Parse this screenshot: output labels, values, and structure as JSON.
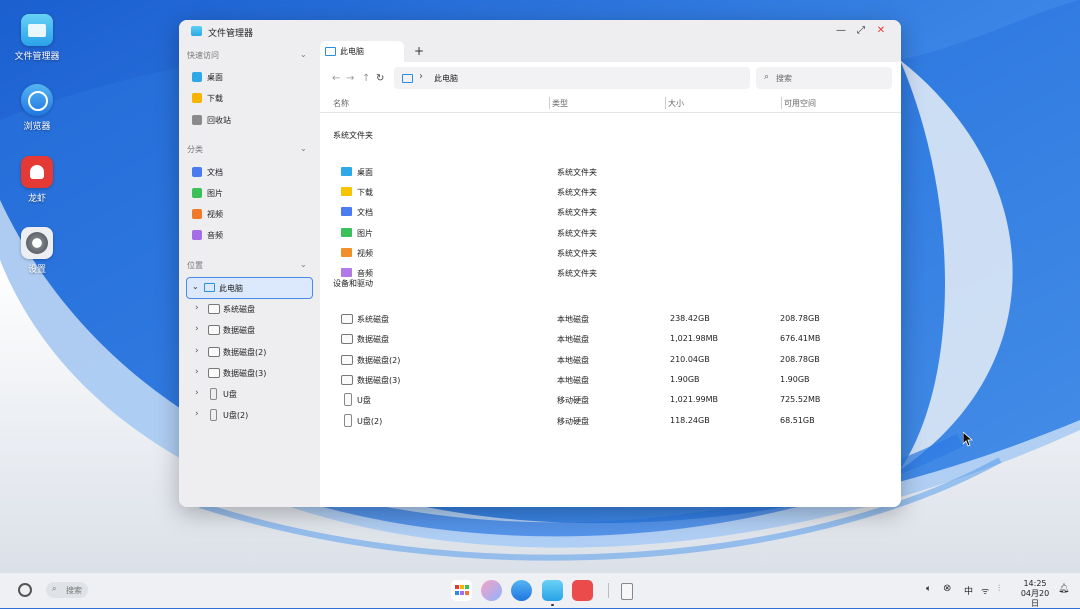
{
  "desktop": {
    "icons": [
      {
        "label": "文件管理器",
        "icon": "file-manager-icon",
        "color": "#3fb6ef"
      },
      {
        "label": "浏览器",
        "icon": "browser-icon",
        "color": "#2d8ae8"
      },
      {
        "label": "龙虾",
        "icon": "lobster-icon",
        "color": "#e53935"
      },
      {
        "label": "设置",
        "icon": "settings-icon",
        "color": "#7b7f86"
      }
    ]
  },
  "window": {
    "title": "文件管理器",
    "controls": {
      "minimize": "—",
      "restore": "⤢",
      "close": "✕"
    }
  },
  "sidebar": {
    "quick_access": {
      "label": "快速访问",
      "items": [
        {
          "label": "桌面",
          "icon": "desktop-icon",
          "color": "#2fa8e8"
        },
        {
          "label": "下载",
          "icon": "download-icon",
          "color": "#f6b400"
        },
        {
          "label": "回收站",
          "icon": "trash-icon",
          "color": "#8a8a8a"
        }
      ]
    },
    "categories": {
      "label": "分类",
      "items": [
        {
          "label": "文档",
          "icon": "document-icon",
          "color": "#4a7cf0"
        },
        {
          "label": "图片",
          "icon": "picture-icon",
          "color": "#3cc15a"
        },
        {
          "label": "视频",
          "icon": "video-icon",
          "color": "#f07a2a"
        },
        {
          "label": "音频",
          "icon": "audio-icon",
          "color": "#a56ee6"
        }
      ]
    },
    "locations": {
      "label": "位置",
      "this_pc": "此电脑",
      "drives": [
        "系统磁盘",
        "数据磁盘",
        "数据磁盘(2)",
        "数据磁盘(3)",
        "U盘",
        "U盘(2)"
      ]
    }
  },
  "tabs": {
    "items": [
      {
        "label": "此电脑"
      }
    ],
    "add": "+"
  },
  "address": {
    "back": "←",
    "forward": "→",
    "up": "↑",
    "refresh": "↻",
    "separator": "›",
    "crumb": "此电脑",
    "search_placeholder": "搜索"
  },
  "columns": {
    "name": "名称",
    "type": "类型",
    "size": "大小",
    "free": "可用空间"
  },
  "system_folders": {
    "label": "系统文件夹",
    "rows": [
      {
        "name": "桌面",
        "type": "系统文件夹",
        "color": "#2fa8e8"
      },
      {
        "name": "下载",
        "type": "系统文件夹",
        "color": "#f6c400"
      },
      {
        "name": "文档",
        "type": "系统文件夹",
        "color": "#4a7cf0"
      },
      {
        "name": "图片",
        "type": "系统文件夹",
        "color": "#3cc15a"
      },
      {
        "name": "视频",
        "type": "系统文件夹",
        "color": "#f0902a"
      },
      {
        "name": "音频",
        "type": "系统文件夹",
        "color": "#b07ae8"
      }
    ]
  },
  "devices": {
    "label": "设备和驱动",
    "rows": [
      {
        "name": "系统磁盘",
        "type": "本地磁盘",
        "size": "238.42GB",
        "free": "208.78GB",
        "kind": "disk"
      },
      {
        "name": "数据磁盘",
        "type": "本地磁盘",
        "size": "1,021.98MB",
        "free": "676.41MB",
        "kind": "disk"
      },
      {
        "name": "数据磁盘(2)",
        "type": "本地磁盘",
        "size": "210.04GB",
        "free": "208.78GB",
        "kind": "disk"
      },
      {
        "name": "数据磁盘(3)",
        "type": "本地磁盘",
        "size": "1.90GB",
        "free": "1.90GB",
        "kind": "disk"
      },
      {
        "name": "U盘",
        "type": "移动硬盘",
        "size": "1,021.99MB",
        "free": "725.52MB",
        "kind": "usb"
      },
      {
        "name": "U盘(2)",
        "type": "移动硬盘",
        "size": "118.24GB",
        "free": "68.51GB",
        "kind": "usb"
      }
    ]
  },
  "taskbar": {
    "search_placeholder": "搜索",
    "ime": "中",
    "time": "14:25",
    "date": "04月20日"
  }
}
